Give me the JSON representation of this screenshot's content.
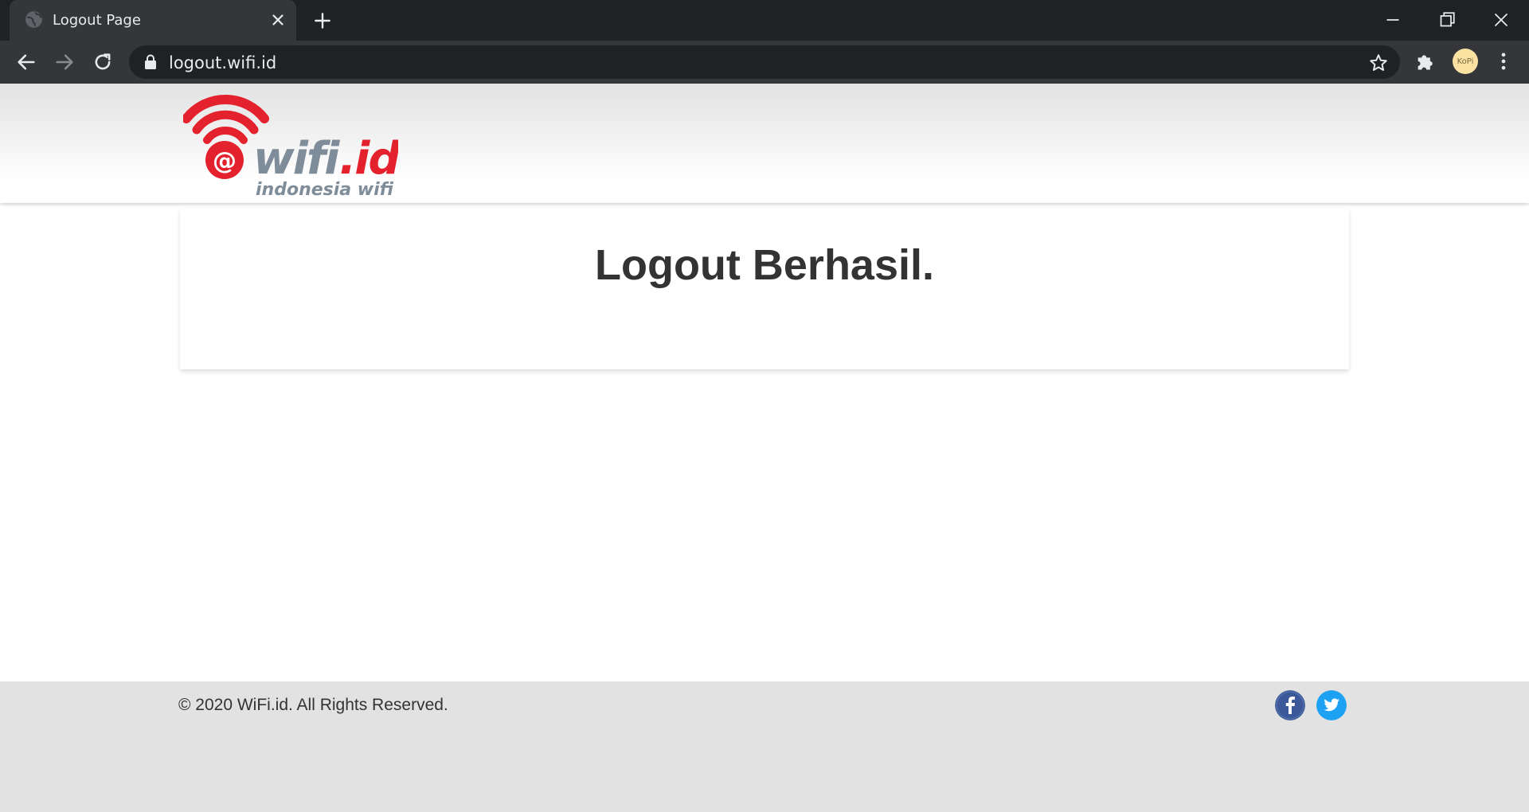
{
  "browser": {
    "tab_title": "Logout Page",
    "url": "logout.wifi.id",
    "profile_initials": "KoPi"
  },
  "header": {
    "logo_alt": "wifi.id indonesia wifi",
    "logo_wordmark": "wifi.id",
    "logo_tagline": "indonesia wifi"
  },
  "main": {
    "title": "Logout Berhasil."
  },
  "footer": {
    "copyright": "© 2020 WiFi.id. All Rights Reserved.",
    "social": [
      "facebook",
      "twitter"
    ]
  },
  "colors": {
    "brand_red": "#e3222d",
    "brand_grey": "#7f8c99",
    "facebook_blue": "#3b5998",
    "twitter_blue": "#1da1f2",
    "footer_bg": "#e2e2e2"
  }
}
